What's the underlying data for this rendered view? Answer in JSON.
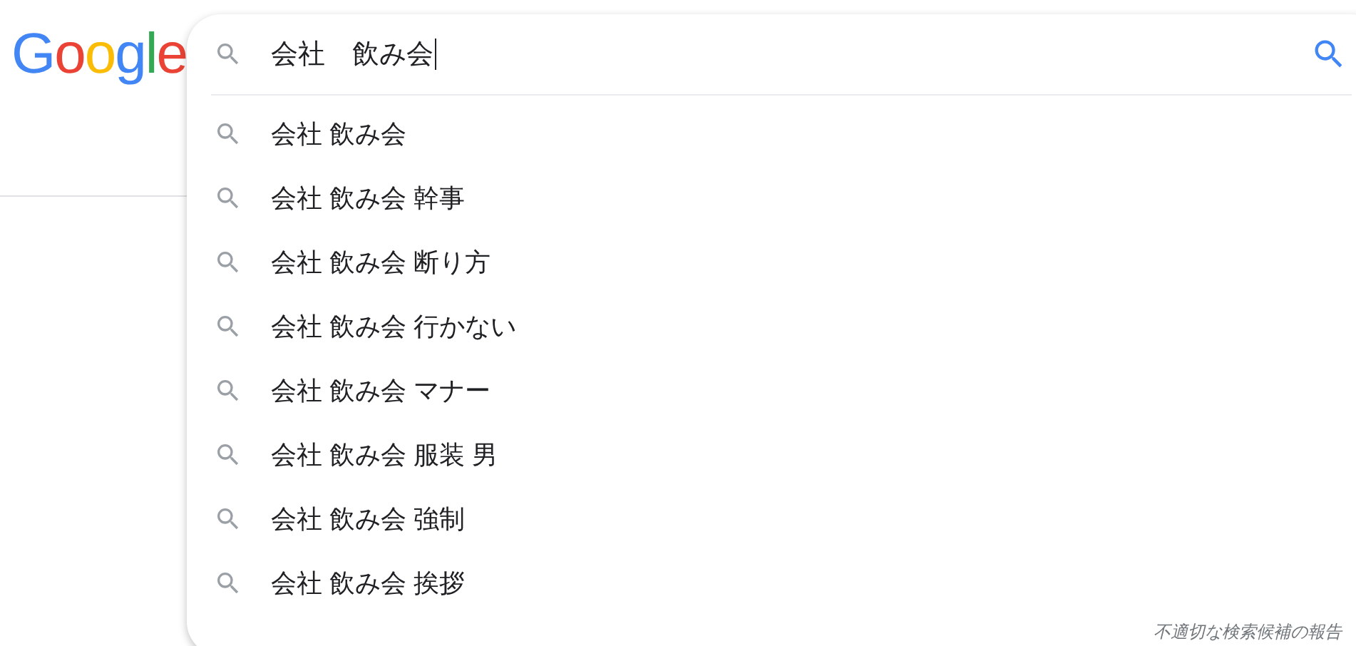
{
  "logo": {
    "letters": [
      {
        "text": "G",
        "color": "#4285f4"
      },
      {
        "text": "o",
        "color": "#ea4335"
      },
      {
        "text": "o",
        "color": "#fbbc05"
      },
      {
        "text": "g",
        "color": "#4285f4"
      },
      {
        "text": "l",
        "color": "#34a853"
      },
      {
        "text": "e",
        "color": "#ea4335"
      }
    ]
  },
  "search": {
    "value": "会社　飲み会",
    "focused": true
  },
  "suggestions": [
    {
      "text": "会社 飲み会"
    },
    {
      "text": "会社 飲み会 幹事"
    },
    {
      "text": "会社 飲み会 断り方"
    },
    {
      "text": "会社 飲み会 行かない"
    },
    {
      "text": "会社 飲み会 マナー"
    },
    {
      "text": "会社 飲み会 服装 男"
    },
    {
      "text": "会社 飲み会 強制"
    },
    {
      "text": "会社 飲み会 挨拶"
    }
  ],
  "report_link": "不適切な検索候補の報告"
}
